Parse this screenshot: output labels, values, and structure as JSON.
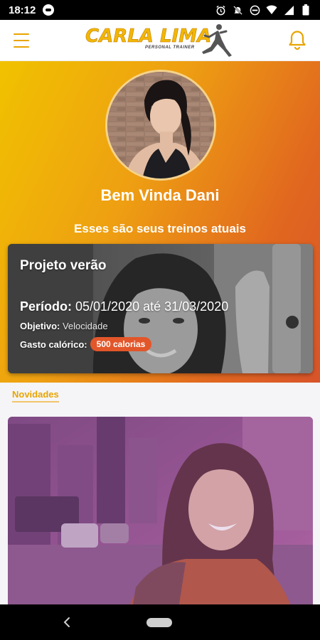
{
  "status_bar": {
    "time": "18:12",
    "icons": [
      "alarm-icon",
      "mute-icon",
      "dnd-icon",
      "wifi-icon",
      "signal-icon",
      "battery-icon"
    ]
  },
  "app_bar": {
    "logo_text": "CARLA LIMA",
    "logo_subtitle": "PERSONAL TRAINER",
    "icons": [
      "menu-icon",
      "bell-icon"
    ]
  },
  "hero": {
    "welcome": "Bem Vinda Dani",
    "subtitle": "Esses são seus treinos atuais"
  },
  "workout_card": {
    "title": "Projeto verão",
    "period_label": "Período:",
    "period_value": " 05/01/2020 até 31/03/2020",
    "goal_label": "Objetivo:",
    "goal_value": " Velocidade",
    "calories_label": "Gasto calórico:",
    "calories_value": "500 calorias"
  },
  "news": {
    "heading": "Novidades"
  },
  "colors": {
    "accent": "#e9a400",
    "gradient_start": "#f1c200",
    "gradient_end": "#d8542a",
    "badge": "#e2562a"
  }
}
